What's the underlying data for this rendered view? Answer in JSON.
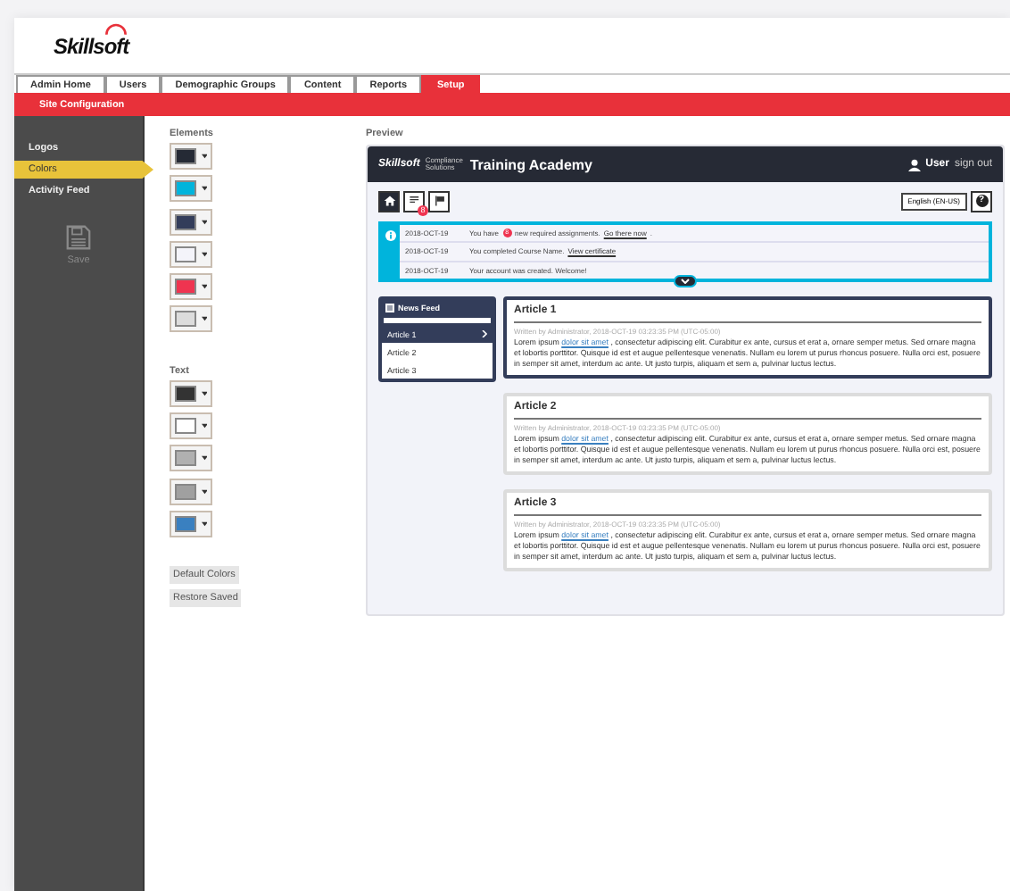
{
  "logo": {
    "text": "Skillsoft"
  },
  "tabs": [
    {
      "label": "Admin Home",
      "selected": false
    },
    {
      "label": "Users",
      "selected": false
    },
    {
      "label": "Demographic Groups",
      "selected": false
    },
    {
      "label": "Content",
      "selected": false
    },
    {
      "label": "Reports",
      "selected": false
    },
    {
      "label": "Setup",
      "selected": true
    }
  ],
  "section_bar": {
    "title": "Site Configuration"
  },
  "sidebar": {
    "items": [
      {
        "label": "Logos",
        "selected": false
      },
      {
        "label": "Colors",
        "selected": true
      },
      {
        "label": "Activity Feed",
        "selected": false
      }
    ],
    "save": {
      "label": "Save",
      "disabled": true
    }
  },
  "elements": {
    "heading": "Elements",
    "swatches": [
      {
        "color": "#252a35"
      },
      {
        "color": "#00b4dc"
      },
      {
        "color": "#333d5a"
      },
      {
        "color": "#f4f4fa"
      },
      {
        "color": "#ef3450"
      },
      {
        "color": "#dcdcdc"
      }
    ]
  },
  "text_colors": {
    "heading": "Text",
    "swatches": [
      {
        "color": "#333333"
      },
      {
        "color": "#ffffff"
      },
      {
        "color": "#b0b0b0"
      },
      {
        "color": "#a0a0a0"
      },
      {
        "color": "#3a80c0"
      }
    ]
  },
  "buttons": [
    "Default Colors",
    "Restore Saved"
  ],
  "preview": {
    "heading": "Preview",
    "brand": "Skillsoft",
    "brand_sub": "Compliance Solutions",
    "title": "Training Academy",
    "user": "User",
    "sign_out": "sign out",
    "language": "English (EN-US)",
    "help": "?",
    "toolbar_badge": "8",
    "notifications": [
      {
        "date": "2018-OCT-19",
        "text": "You have",
        "badge": "8",
        "after": "new required assignments.",
        "link": "Go there now",
        "end": "."
      },
      {
        "date": "2018-OCT-19",
        "text": "You completed Course Name.",
        "link": "View certificate"
      },
      {
        "date": "2018-OCT-19",
        "text": "Your account was created. Welcome!"
      }
    ],
    "news_feed": {
      "title": "News Feed",
      "items": [
        {
          "label": "Article 1",
          "selected": true
        },
        {
          "label": "Article 2",
          "selected": false
        },
        {
          "label": "Article 3",
          "selected": false
        }
      ]
    },
    "articles": [
      {
        "title": "Article 1",
        "selected": true,
        "byline": "Written by Administrator, 2018-OCT-19 03:23:35 PM (UTC-05:00)",
        "before": "Lorem ipsum",
        "link": "dolor sit amet",
        "after": ", consectetur adipiscing elit. Curabitur ex ante, cursus et erat a, ornare semper metus. Sed ornare magna et lobortis porttitor. Quisque id est et augue pellentesque venenatis. Nullam eu lorem ut purus rhoncus posuere. Nulla orci est, posuere in semper sit amet, interdum ac ante. Ut justo turpis, aliquam et sem a, pulvinar luctus lectus."
      },
      {
        "title": "Article 2",
        "selected": false,
        "byline": "Written by Administrator, 2018-OCT-19 03:23:35 PM (UTC-05:00)",
        "before": "Lorem ipsum",
        "link": "dolor sit amet",
        "after": ", consectetur adipiscing elit. Curabitur ex ante, cursus et erat a, ornare semper metus. Sed ornare magna et lobortis porttitor. Quisque id est et augue pellentesque venenatis. Nullam eu lorem ut purus rhoncus posuere. Nulla orci est, posuere in semper sit amet, interdum ac ante. Ut justo turpis, aliquam et sem a, pulvinar luctus lectus."
      },
      {
        "title": "Article 3",
        "selected": false,
        "byline": "Written by Administrator, 2018-OCT-19 03:23:35 PM (UTC-05:00)",
        "before": "Lorem ipsum",
        "link": "dolor sit amet",
        "after": ", consectetur adipiscing elit. Curabitur ex ante, cursus et erat a, ornare semper metus. Sed ornare magna et lobortis porttitor. Quisque id est et augue pellentesque venenatis. Nullam eu lorem ut purus rhoncus posuere. Nulla orci est, posuere in semper sit amet, interdum ac ante. Ut justo turpis, aliquam et sem a, pulvinar luctus lectus."
      }
    ]
  }
}
